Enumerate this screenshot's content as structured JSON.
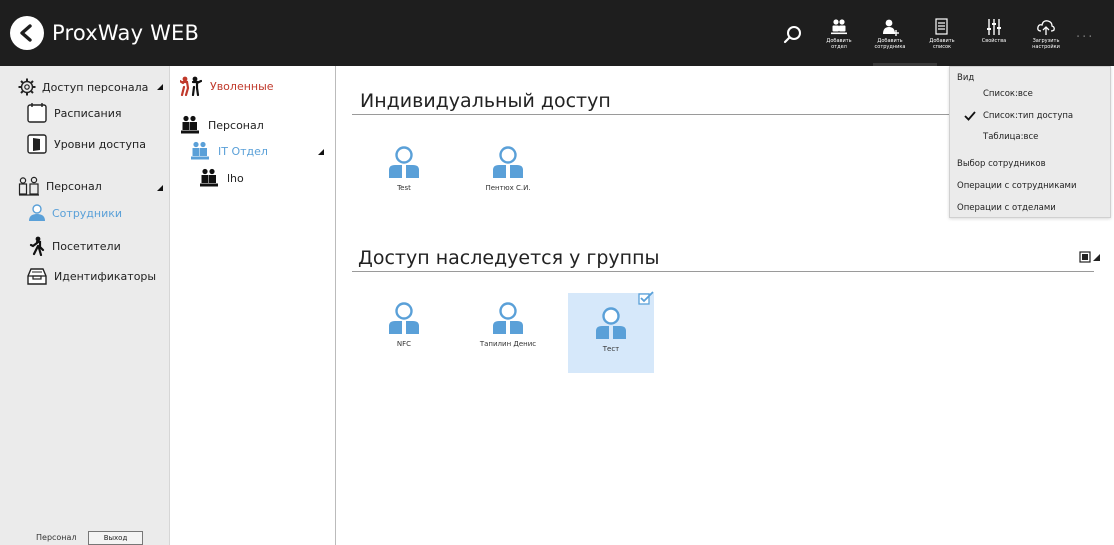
{
  "app": {
    "title": "ProxWay WEB"
  },
  "toolbar": {
    "buttons": [
      {
        "label": "Добавить\nотдел",
        "icon": "add-department-icon"
      },
      {
        "label": "Добавить\nсотрудника",
        "icon": "add-employee-icon"
      },
      {
        "label": "Добавить\nсписок",
        "icon": "add-list-icon"
      },
      {
        "label": "Свойства",
        "icon": "properties-icon"
      },
      {
        "label": "Загрузить\nнастройки",
        "icon": "upload-cloud-icon"
      }
    ],
    "more": "..."
  },
  "nav": {
    "items": [
      {
        "label": "Доступ персонала",
        "icon": "gear-icon",
        "expandable": true
      },
      {
        "label": "Расписания",
        "icon": "calendar-icon"
      },
      {
        "label": "Уровни доступа",
        "icon": "door-icon"
      },
      {
        "label": "Персонал",
        "icon": "staff-icon",
        "expandable": true
      },
      {
        "label": "Сотрудники",
        "icon": "employee-icon",
        "active": true
      },
      {
        "label": "Посетители",
        "icon": "visitor-icon"
      },
      {
        "label": "Идентификаторы",
        "icon": "id-tray-icon"
      }
    ],
    "footer": {
      "label": "Персонал",
      "exit": "Выход"
    }
  },
  "tree": {
    "items": [
      {
        "label": "Уволенные",
        "color": "#c0392b"
      },
      {
        "label": "Персонал",
        "color": "#222222"
      },
      {
        "label": "IT Отдел",
        "color": "#5aa0d8"
      },
      {
        "label": "lho",
        "color": "#222222"
      }
    ]
  },
  "main": {
    "individual": {
      "title": "Индивидуальный доступ",
      "people": [
        {
          "name": "Test"
        },
        {
          "name": "Пентюх С.И."
        }
      ]
    },
    "group": {
      "title": "Доступ наследуется у группы",
      "people": [
        {
          "name": "NFC"
        },
        {
          "name": "Тапилин Денис"
        },
        {
          "name": "Тест",
          "selected": true
        }
      ]
    }
  },
  "view_menu": {
    "header": "Вид",
    "items": [
      {
        "label": "Список:все",
        "checked": false
      },
      {
        "label": "Список:тип доступа",
        "checked": true
      },
      {
        "label": "Таблица:все",
        "checked": false
      },
      {
        "label": "Выбор сотрудников"
      },
      {
        "label": "Операции с сотрудниками"
      },
      {
        "label": "Операции с отделами"
      }
    ]
  },
  "colors": {
    "accent": "#5aa0d8",
    "topbar": "#1e1e1e",
    "nav_bg": "#ebebeb",
    "selected_bg": "#d6e8fa",
    "fired": "#c0392b"
  }
}
